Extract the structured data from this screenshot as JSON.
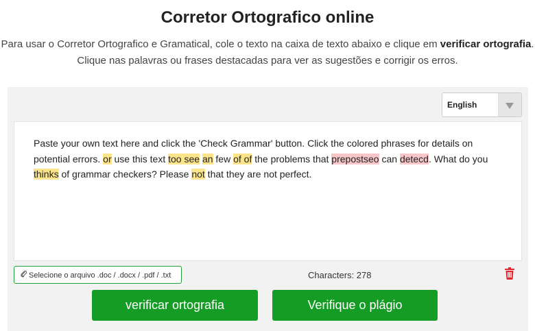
{
  "header": {
    "title": "Corretor Ortografico online",
    "subtitle_line1_prefix": "Para usar o Corretor Ortografico e Gramatical, cole o texto na caixa de texto abaixo e clique em ",
    "subtitle_line1_bold": "verificar ortografia",
    "subtitle_line1_suffix": ".",
    "subtitle_line2": "Clique nas palavras ou frases destacadas para ver as sugestões e corrigir os erros."
  },
  "language_select": {
    "selected": "English"
  },
  "editor": {
    "segments": [
      {
        "text": "Paste your own text here and click the 'Check Grammar' button. Click the colored phrases for details on potential errors. ",
        "hl": null
      },
      {
        "text": "or",
        "hl": "yellow"
      },
      {
        "text": " use this text ",
        "hl": null
      },
      {
        "text": "too see",
        "hl": "yellow"
      },
      {
        "text": " ",
        "hl": null
      },
      {
        "text": "an",
        "hl": "yellow"
      },
      {
        "text": " few ",
        "hl": null
      },
      {
        "text": "of of",
        "hl": "yellow"
      },
      {
        "text": " the problems that ",
        "hl": null
      },
      {
        "text": "prepostseo",
        "hl": "red"
      },
      {
        "text": " can ",
        "hl": null
      },
      {
        "text": "detecd",
        "hl": "red"
      },
      {
        "text": ". What do you ",
        "hl": null
      },
      {
        "text": "thinks",
        "hl": "yellow"
      },
      {
        "text": " of grammar checkers? Please ",
        "hl": null
      },
      {
        "text": "not",
        "hl": "yellow"
      },
      {
        "text": " that they are not perfect.",
        "hl": null
      }
    ]
  },
  "file_upload": {
    "label": "Selecione o arquivo .doc / .docx / .pdf / .txt",
    "icon": "paperclip-icon"
  },
  "character_count": "Characters: 278",
  "delete": {
    "icon": "trash-icon"
  },
  "buttons": {
    "check": "verificar ortografia",
    "plagiarism": "Verifique o plágio"
  },
  "colors": {
    "accent_green": "#159c24",
    "highlight_yellow": "#fce48a",
    "highlight_red": "#f7c6c8",
    "trash_red": "#e0262e"
  }
}
